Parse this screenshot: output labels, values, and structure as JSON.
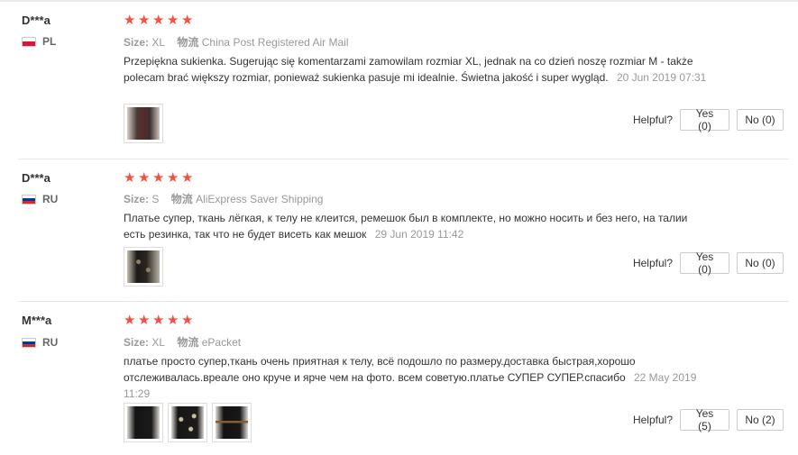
{
  "reviews": [
    {
      "user": "D***a",
      "country": "PL",
      "flag_colors": [
        "#ffffff",
        "#dc143c"
      ],
      "stars": 5,
      "size_label": "Size:",
      "size": "XL",
      "logistics_label": "物流",
      "logistics": "China Post Registered Air Mail",
      "text": "Przepiękna sukienka. Sugerując się komentarzami zamowilam rozmiar XL, jednak na co dzień noszę rozmiar M - także polecam brać większy rozmiar, ponieważ sukienka pasuje mi idealnie. Świetna jakość i super wygląd.",
      "date": "20 Jun 2019 07:31",
      "photos": [
        "photo-1"
      ],
      "helpful_label": "Helpful?",
      "yes_label": "Yes (0)",
      "no_label": "No (0)"
    },
    {
      "user": "D***a",
      "country": "RU",
      "flag_colors": [
        "#ffffff",
        "#0039a6",
        "#d52b1e"
      ],
      "stars": 5,
      "size_label": "Size:",
      "size": "S",
      "logistics_label": "物流",
      "logistics": "AliExpress Saver Shipping",
      "text": "Платье супер, ткань лёгкая, к телу не клеится, ремешок был в комплекте, но можно носить и без него, на талии есть резинка, так что не будет висеть как мешок",
      "date": "29 Jun 2019 11:42",
      "photos": [
        "photo-1"
      ],
      "helpful_label": "Helpful?",
      "yes_label": "Yes (0)",
      "no_label": "No (0)"
    },
    {
      "user": "M***a",
      "country": "RU",
      "flag_colors": [
        "#ffffff",
        "#0039a6",
        "#d52b1e"
      ],
      "stars": 5,
      "size_label": "Size:",
      "size": "XL",
      "logistics_label": "物流",
      "logistics": "ePacket",
      "text": "платье просто супер,ткань очень приятная к телу, всё подошло по размеру.доставка быстрая,хорошо отслеживалась.вреале оно круче и ярче чем на фото. всем советую.платье СУПЕР СУПЕР.спасибо",
      "date": "22 May 2019 11:29",
      "photos": [
        "photo-1",
        "photo-2",
        "photo-3"
      ],
      "helpful_label": "Helpful?",
      "yes_label": "Yes (5)",
      "no_label": "No (2)"
    }
  ]
}
